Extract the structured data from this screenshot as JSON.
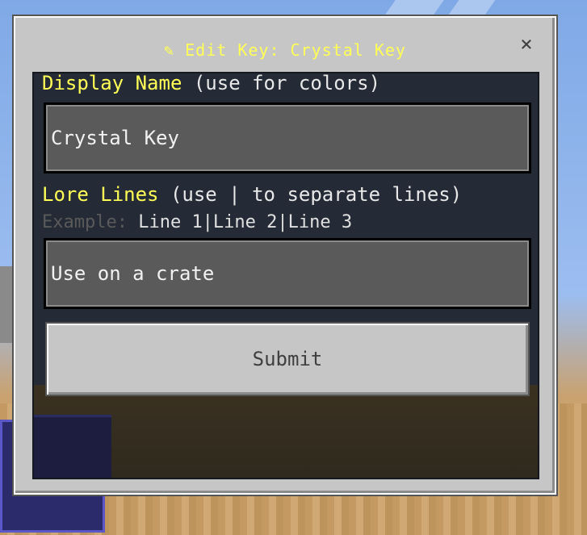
{
  "dialog": {
    "title_icon": "✎",
    "title": "Edit Key: Crystal Key",
    "close_label": "×"
  },
  "display_name": {
    "label_highlight": "Display Name",
    "label_hint": " (use for colors)",
    "value": "Crystal Key"
  },
  "lore_lines": {
    "label_highlight": "Lore Lines",
    "label_hint": " (use | to separate lines)",
    "example_label": "Example:",
    "example_value": " Line 1|Line 2|Line 3",
    "value": "Use on a crate"
  },
  "submit_label": "Submit",
  "colors": {
    "highlight": "#ffff55",
    "panel": "#c6c6c6",
    "content_bg": "#242a36"
  }
}
